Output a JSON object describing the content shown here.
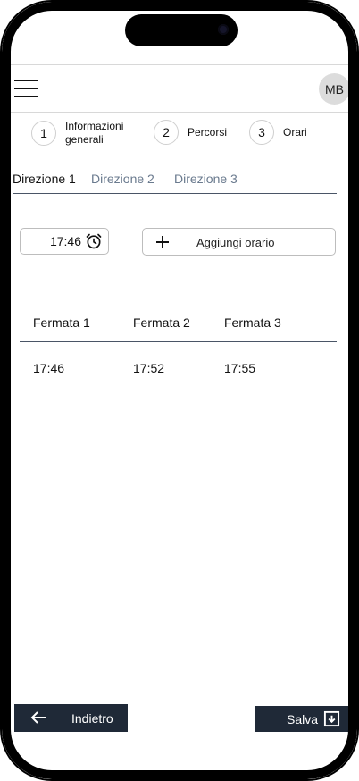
{
  "header": {
    "avatar_initials": "MB"
  },
  "steps": [
    {
      "number": "1",
      "label": "Informazioni generali"
    },
    {
      "number": "2",
      "label": "Percorsi"
    },
    {
      "number": "3",
      "label": "Orari"
    }
  ],
  "tabs": [
    {
      "label": "Direzione 1",
      "active": true
    },
    {
      "label": "Direzione 2",
      "active": false
    },
    {
      "label": "Direzione 3",
      "active": false
    }
  ],
  "time_input": {
    "value": "17:46",
    "icon": "alarm-clock-icon"
  },
  "add_button": {
    "label": "Aggiungi orario",
    "icon": "plus-icon"
  },
  "table": {
    "headers": [
      "Fermata 1",
      "Fermata 2",
      "Fermata 3"
    ],
    "rows": [
      [
        "17:46",
        "17:52",
        "17:55"
      ]
    ]
  },
  "footer": {
    "back_label": "Indietro",
    "save_label": "Salva"
  },
  "colors": {
    "primary_dark": "#1f2937",
    "tab_inactive": "#6a7a8e"
  }
}
